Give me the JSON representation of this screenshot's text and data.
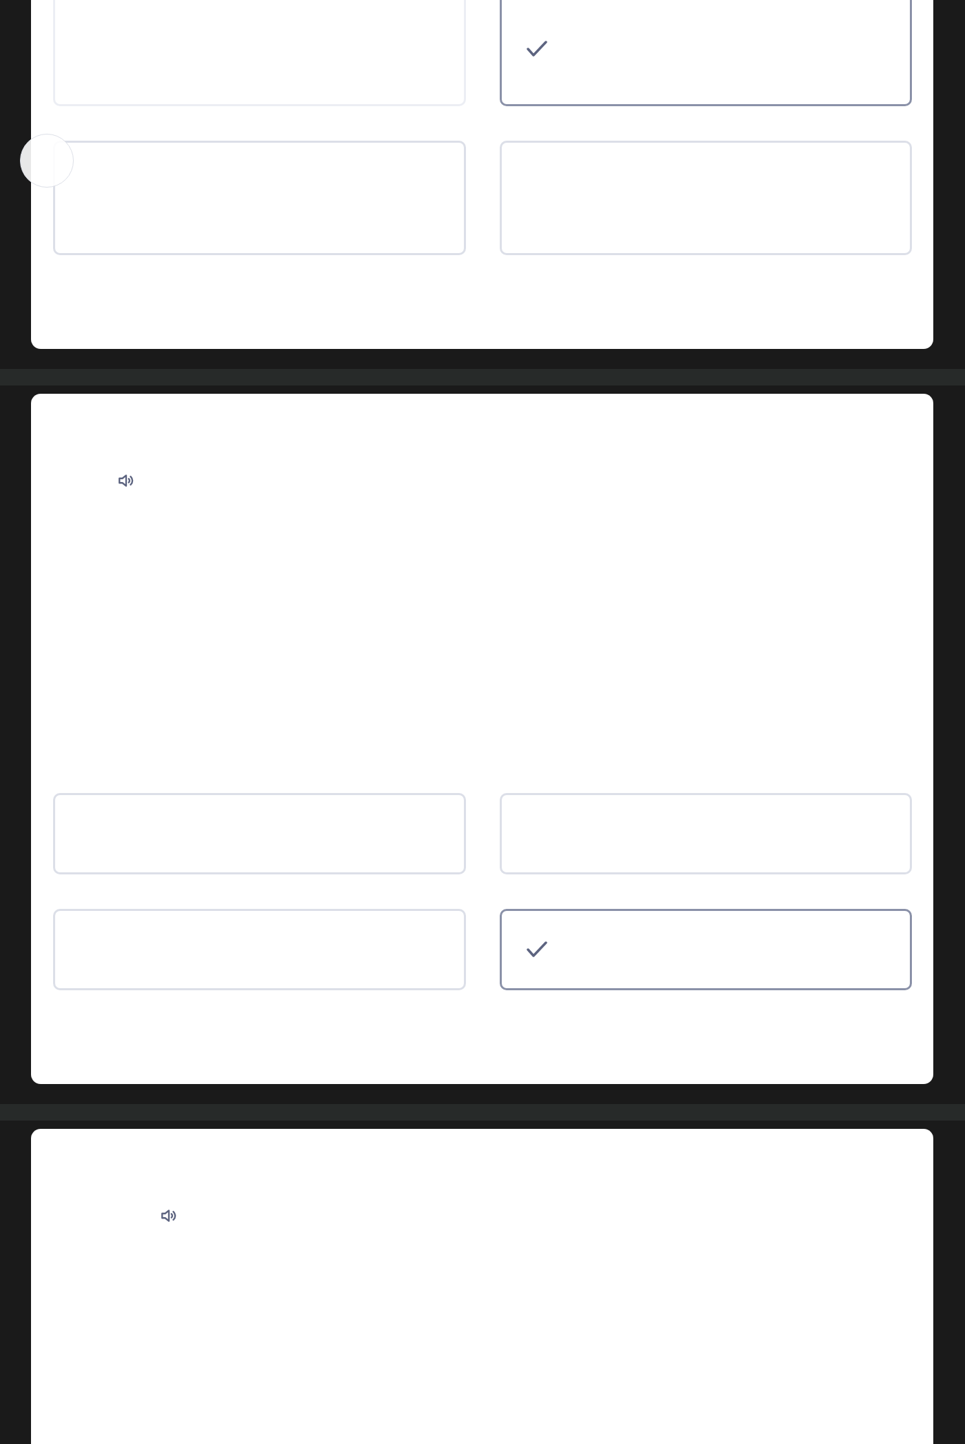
{
  "questions": [
    {
      "audio": false,
      "options": [
        {
          "selected": false,
          "faded": true
        },
        {
          "selected": true,
          "faded": false
        },
        {
          "selected": false,
          "faded": false
        },
        {
          "selected": false,
          "faded": false
        }
      ]
    },
    {
      "audio": true,
      "options": [
        {
          "selected": false,
          "faded": false
        },
        {
          "selected": false,
          "faded": false
        },
        {
          "selected": false,
          "faded": false
        },
        {
          "selected": true,
          "faded": false
        }
      ]
    },
    {
      "audio": true
    }
  ]
}
